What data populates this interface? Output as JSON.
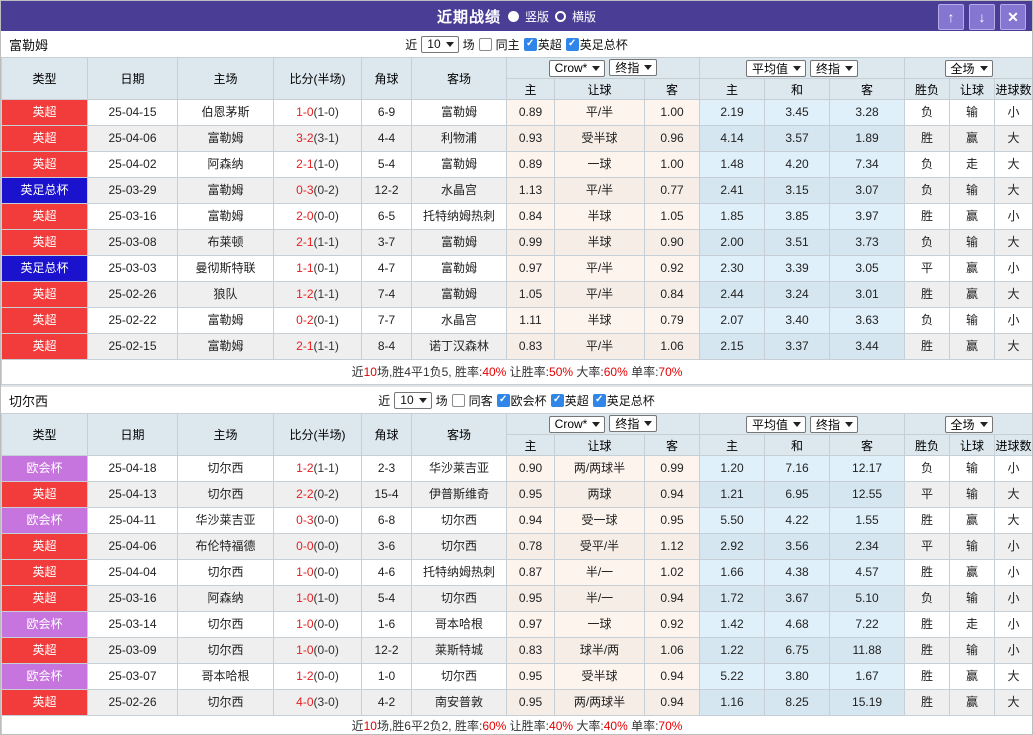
{
  "titlebar": {
    "title": "近期战绩",
    "vertical_label": "竖版",
    "horizontal_label": "横版",
    "up_glyph": "↑",
    "down_glyph": "↓",
    "close_glyph": "✕"
  },
  "labels": {
    "near": "近",
    "games": "场",
    "check": "✓"
  },
  "table_header": {
    "static_cols": [
      "类型",
      "日期",
      "主场",
      "比分(半场)",
      "角球",
      "客场"
    ],
    "odds_selects": [
      "Crow*",
      "终指"
    ],
    "odds_subcols": [
      "主",
      "让球",
      "客"
    ],
    "avg_selects": [
      "平均值",
      "终指"
    ],
    "avg_subcols": [
      "主",
      "和",
      "客"
    ],
    "scope_select": "全场",
    "full_subcols": [
      "胜负",
      "让球",
      "进球数"
    ]
  },
  "colors": {
    "titlebar": "#4a3d96",
    "epl_badge": "#f23c3c",
    "facup_badge": "#1b12cd",
    "uecl_badge": "#c775de",
    "team_green": "#2f9e2f",
    "score_red": "#e62020",
    "win_red": "#e04040",
    "loss_blue": "#3434cf",
    "draw_green": "#2d8d2d",
    "summary_red": "#e60000",
    "avg_col_bg": "#e4f1fa",
    "header_bg": "#dce7ee"
  },
  "sections": [
    {
      "team": "富勒姆",
      "filter": {
        "count": "10",
        "same_label": "同主",
        "same_checked": false,
        "leagues": [
          "英超",
          "英足总杯"
        ]
      },
      "rows": [
        {
          "league": "英超",
          "lcolor": "red",
          "date": "25-04-15",
          "home": "伯恩茅斯",
          "home_team": false,
          "score": "1-0",
          "half": "(1-0)",
          "corners": "6-9",
          "away": "富勒姆",
          "away_team": true,
          "o_home": "0.89",
          "o_line": "平/半",
          "o_away": "1.00",
          "avg_home": "2.19",
          "avg_draw": "3.45",
          "avg_away": "3.28",
          "res": [
            [
              "负",
              "blue"
            ],
            [
              "输",
              "blue"
            ],
            [
              "小",
              "blue"
            ]
          ]
        },
        {
          "league": "英超",
          "lcolor": "red",
          "date": "25-04-06",
          "home": "富勒姆",
          "home_team": true,
          "score": "3-2",
          "half": "(3-1)",
          "corners": "4-4",
          "away": "利物浦",
          "away_team": false,
          "o_home": "0.93",
          "o_line": "受半球",
          "o_away": "0.96",
          "avg_home": "4.14",
          "avg_draw": "3.57",
          "avg_away": "1.89",
          "res": [
            [
              "胜",
              "red"
            ],
            [
              "赢",
              "red"
            ],
            [
              "大",
              "red"
            ]
          ]
        },
        {
          "league": "英超",
          "lcolor": "red",
          "date": "25-04-02",
          "home": "阿森纳",
          "home_team": false,
          "score": "2-1",
          "half": "(1-0)",
          "corners": "5-4",
          "away": "富勒姆",
          "away_team": true,
          "o_home": "0.89",
          "o_line": "一球",
          "o_away": "1.00",
          "avg_home": "1.48",
          "avg_draw": "4.20",
          "avg_away": "7.34",
          "res": [
            [
              "负",
              "blue"
            ],
            [
              "走",
              "green"
            ],
            [
              "大",
              "red"
            ]
          ]
        },
        {
          "league": "英足总杯",
          "lcolor": "blue",
          "date": "25-03-29",
          "home": "富勒姆",
          "home_team": true,
          "score": "0-3",
          "half": "(0-2)",
          "corners": "12-2",
          "away": "水晶宫",
          "away_team": false,
          "o_home": "1.13",
          "o_line": "平/半",
          "o_away": "0.77",
          "avg_home": "2.41",
          "avg_draw": "3.15",
          "avg_away": "3.07",
          "res": [
            [
              "负",
              "blue"
            ],
            [
              "输",
              "blue"
            ],
            [
              "大",
              "red"
            ]
          ]
        },
        {
          "league": "英超",
          "lcolor": "red",
          "date": "25-03-16",
          "home": "富勒姆",
          "home_team": true,
          "score": "2-0",
          "half": "(0-0)",
          "corners": "6-5",
          "away": "托特纳姆热刺",
          "away_team": false,
          "o_home": "0.84",
          "o_line": "半球",
          "o_away": "1.05",
          "avg_home": "1.85",
          "avg_draw": "3.85",
          "avg_away": "3.97",
          "res": [
            [
              "胜",
              "red"
            ],
            [
              "赢",
              "red"
            ],
            [
              "小",
              "blue"
            ]
          ]
        },
        {
          "league": "英超",
          "lcolor": "red",
          "date": "25-03-08",
          "home": "布莱顿",
          "home_team": false,
          "score": "2-1",
          "half": "(1-1)",
          "corners": "3-7",
          "away": "富勒姆",
          "away_team": true,
          "o_home": "0.99",
          "o_line": "半球",
          "o_away": "0.90",
          "avg_home": "2.00",
          "avg_draw": "3.51",
          "avg_away": "3.73",
          "res": [
            [
              "负",
              "blue"
            ],
            [
              "输",
              "blue"
            ],
            [
              "大",
              "red"
            ]
          ]
        },
        {
          "league": "英足总杯",
          "lcolor": "blue",
          "date": "25-03-03",
          "home": "曼彻斯特联",
          "home_team": false,
          "score": "1-1",
          "half": "(0-1)",
          "corners": "4-7",
          "away": "富勒姆",
          "away_team": true,
          "o_home": "0.97",
          "o_line": "平/半",
          "o_away": "0.92",
          "avg_home": "2.30",
          "avg_draw": "3.39",
          "avg_away": "3.05",
          "res": [
            [
              "平",
              "green"
            ],
            [
              "赢",
              "red"
            ],
            [
              "小",
              "blue"
            ]
          ]
        },
        {
          "league": "英超",
          "lcolor": "red",
          "date": "25-02-26",
          "home": "狼队",
          "home_team": false,
          "score": "1-2",
          "half": "(1-1)",
          "corners": "7-4",
          "away": "富勒姆",
          "away_team": true,
          "o_home": "1.05",
          "o_line": "平/半",
          "o_away": "0.84",
          "avg_home": "2.44",
          "avg_draw": "3.24",
          "avg_away": "3.01",
          "res": [
            [
              "胜",
              "red"
            ],
            [
              "赢",
              "red"
            ],
            [
              "大",
              "red"
            ]
          ]
        },
        {
          "league": "英超",
          "lcolor": "red",
          "date": "25-02-22",
          "home": "富勒姆",
          "home_team": true,
          "score": "0-2",
          "half": "(0-1)",
          "corners": "7-7",
          "away": "水晶宫",
          "away_team": false,
          "o_home": "1.11",
          "o_line": "半球",
          "o_away": "0.79",
          "avg_home": "2.07",
          "avg_draw": "3.40",
          "avg_away": "3.63",
          "res": [
            [
              "负",
              "blue"
            ],
            [
              "输",
              "blue"
            ],
            [
              "小",
              "blue"
            ]
          ]
        },
        {
          "league": "英超",
          "lcolor": "red",
          "date": "25-02-15",
          "home": "富勒姆",
          "home_team": true,
          "score": "2-1",
          "half": "(1-1)",
          "corners": "8-4",
          "away": "诺丁汉森林",
          "away_team": false,
          "o_home": "0.83",
          "o_line": "平/半",
          "o_away": "1.06",
          "avg_home": "2.15",
          "avg_draw": "3.37",
          "avg_away": "3.44",
          "res": [
            [
              "胜",
              "red"
            ],
            [
              "赢",
              "red"
            ],
            [
              "大",
              "red"
            ]
          ]
        }
      ],
      "summary": [
        [
          "近",
          "k"
        ],
        [
          "10",
          "r"
        ],
        [
          "场,胜4平1负5, 胜率:",
          "k"
        ],
        [
          "40%",
          "r"
        ],
        [
          " 让胜率:",
          "k"
        ],
        [
          "50%",
          "r"
        ],
        [
          " 大率:",
          "k"
        ],
        [
          "60%",
          "r"
        ],
        [
          " 单率:",
          "k"
        ],
        [
          "70%",
          "r"
        ]
      ]
    },
    {
      "team": "切尔西",
      "filter": {
        "count": "10",
        "same_label": "同客",
        "same_checked": false,
        "leagues": [
          "欧会杯",
          "英超",
          "英足总杯"
        ]
      },
      "rows": [
        {
          "league": "欧会杯",
          "lcolor": "purple",
          "date": "25-04-18",
          "home": "切尔西",
          "home_team": true,
          "score": "1-2",
          "half": "(1-1)",
          "corners": "2-3",
          "away": "华沙莱吉亚",
          "away_team": false,
          "o_home": "0.90",
          "o_line": "两/两球半",
          "o_away": "0.99",
          "avg_home": "1.20",
          "avg_draw": "7.16",
          "avg_away": "12.17",
          "res": [
            [
              "负",
              "blue"
            ],
            [
              "输",
              "blue"
            ],
            [
              "小",
              "blue"
            ]
          ]
        },
        {
          "league": "英超",
          "lcolor": "red",
          "date": "25-04-13",
          "home": "切尔西",
          "home_team": true,
          "score": "2-2",
          "half": "(0-2)",
          "corners": "15-4",
          "away": "伊普斯维奇",
          "away_team": false,
          "o_home": "0.95",
          "o_line": "两球",
          "o_away": "0.94",
          "avg_home": "1.21",
          "avg_draw": "6.95",
          "avg_away": "12.55",
          "res": [
            [
              "平",
              "green"
            ],
            [
              "输",
              "blue"
            ],
            [
              "大",
              "red"
            ]
          ]
        },
        {
          "league": "欧会杯",
          "lcolor": "purple",
          "date": "25-04-11",
          "home": "华沙莱吉亚",
          "home_team": false,
          "score": "0-3",
          "half": "(0-0)",
          "corners": "6-8",
          "away": "切尔西",
          "away_team": true,
          "o_home": "0.94",
          "o_line": "受一球",
          "o_away": "0.95",
          "avg_home": "5.50",
          "avg_draw": "4.22",
          "avg_away": "1.55",
          "res": [
            [
              "胜",
              "red"
            ],
            [
              "赢",
              "red"
            ],
            [
              "大",
              "red"
            ]
          ]
        },
        {
          "league": "英超",
          "lcolor": "red",
          "date": "25-04-06",
          "home": "布伦特福德",
          "home_team": false,
          "score": "0-0",
          "half": "(0-0)",
          "corners": "3-6",
          "away": "切尔西",
          "away_team": true,
          "o_home": "0.78",
          "o_line": "受平/半",
          "o_away": "1.12",
          "avg_home": "2.92",
          "avg_draw": "3.56",
          "avg_away": "2.34",
          "res": [
            [
              "平",
              "green"
            ],
            [
              "输",
              "blue"
            ],
            [
              "小",
              "blue"
            ]
          ]
        },
        {
          "league": "英超",
          "lcolor": "red",
          "date": "25-04-04",
          "home": "切尔西",
          "home_team": true,
          "score": "1-0",
          "half": "(0-0)",
          "corners": "4-6",
          "away": "托特纳姆热刺",
          "away_team": false,
          "o_home": "0.87",
          "o_line": "半/一",
          "o_away": "1.02",
          "avg_home": "1.66",
          "avg_draw": "4.38",
          "avg_away": "4.57",
          "res": [
            [
              "胜",
              "red"
            ],
            [
              "赢",
              "red"
            ],
            [
              "小",
              "blue"
            ]
          ]
        },
        {
          "league": "英超",
          "lcolor": "red",
          "date": "25-03-16",
          "home": "阿森纳",
          "home_team": false,
          "score": "1-0",
          "half": "(1-0)",
          "corners": "5-4",
          "away": "切尔西",
          "away_team": true,
          "o_home": "0.95",
          "o_line": "半/一",
          "o_away": "0.94",
          "avg_home": "1.72",
          "avg_draw": "3.67",
          "avg_away": "5.10",
          "res": [
            [
              "负",
              "blue"
            ],
            [
              "输",
              "blue"
            ],
            [
              "小",
              "blue"
            ]
          ]
        },
        {
          "league": "欧会杯",
          "lcolor": "purple",
          "date": "25-03-14",
          "home": "切尔西",
          "home_team": true,
          "score": "1-0",
          "half": "(0-0)",
          "corners": "1-6",
          "away": "哥本哈根",
          "away_team": false,
          "o_home": "0.97",
          "o_line": "一球",
          "o_away": "0.92",
          "avg_home": "1.42",
          "avg_draw": "4.68",
          "avg_away": "7.22",
          "res": [
            [
              "胜",
              "red"
            ],
            [
              "走",
              "green"
            ],
            [
              "小",
              "blue"
            ]
          ]
        },
        {
          "league": "英超",
          "lcolor": "red",
          "date": "25-03-09",
          "home": "切尔西",
          "home_team": true,
          "score": "1-0",
          "half": "(0-0)",
          "corners": "12-2",
          "away": "莱斯特城",
          "away_team": false,
          "o_home": "0.83",
          "o_line": "球半/两",
          "o_away": "1.06",
          "avg_home": "1.22",
          "avg_draw": "6.75",
          "avg_away": "11.88",
          "res": [
            [
              "胜",
              "red"
            ],
            [
              "输",
              "blue"
            ],
            [
              "小",
              "blue"
            ]
          ]
        },
        {
          "league": "欧会杯",
          "lcolor": "purple",
          "date": "25-03-07",
          "home": "哥本哈根",
          "home_team": false,
          "score": "1-2",
          "half": "(0-0)",
          "corners": "1-0",
          "away": "切尔西",
          "away_team": true,
          "o_home": "0.95",
          "o_line": "受半球",
          "o_away": "0.94",
          "avg_home": "5.22",
          "avg_draw": "3.80",
          "avg_away": "1.67",
          "res": [
            [
              "胜",
              "red"
            ],
            [
              "赢",
              "red"
            ],
            [
              "大",
              "red"
            ]
          ]
        },
        {
          "league": "英超",
          "lcolor": "red",
          "date": "25-02-26",
          "home": "切尔西",
          "home_team": true,
          "score": "4-0",
          "half": "(3-0)",
          "corners": "4-2",
          "away": "南安普敦",
          "away_team": false,
          "o_home": "0.95",
          "o_line": "两/两球半",
          "o_away": "0.94",
          "avg_home": "1.16",
          "avg_draw": "8.25",
          "avg_away": "15.19",
          "res": [
            [
              "胜",
              "red"
            ],
            [
              "赢",
              "red"
            ],
            [
              "大",
              "red"
            ]
          ]
        }
      ],
      "summary": [
        [
          "近",
          "k"
        ],
        [
          "10",
          "r"
        ],
        [
          "场,胜6平2负2, 胜率:",
          "k"
        ],
        [
          "60%",
          "r"
        ],
        [
          " 让胜率:",
          "k"
        ],
        [
          "40%",
          "r"
        ],
        [
          " 大率:",
          "k"
        ],
        [
          "40%",
          "r"
        ],
        [
          " 单率:",
          "k"
        ],
        [
          "70%",
          "r"
        ]
      ]
    }
  ]
}
